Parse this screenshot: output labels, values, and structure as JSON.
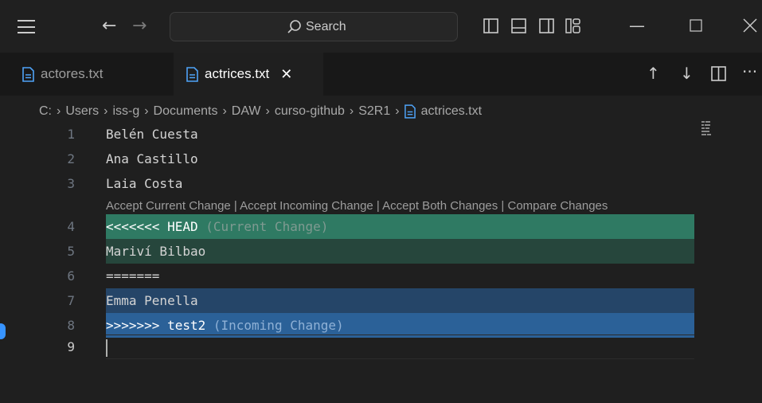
{
  "titlebar": {
    "search_placeholder": "Search",
    "icons": [
      "menu-icon",
      "arrow-left-icon",
      "arrow-right-icon",
      "search-icon",
      "toggle-primary-sidebar-icon",
      "toggle-panel-icon",
      "toggle-secondary-sidebar-icon",
      "customize-layout-icon",
      "minimize-icon",
      "maximize-icon",
      "close-icon"
    ]
  },
  "tabs": [
    {
      "label": "actores.txt",
      "active": false
    },
    {
      "label": "actrices.txt",
      "active": true
    }
  ],
  "tab_actions": [
    "arrow-up-icon",
    "arrow-down-icon",
    "split-editor-icon",
    "more-actions-icon"
  ],
  "breadcrumb": [
    "C:",
    "Users",
    "iss-g",
    "Documents",
    "DAW",
    "curso-github",
    "S2R1",
    "actrices.txt"
  ],
  "codelens": "Accept Current Change | Accept Incoming Change | Accept Both Changes | Compare Changes",
  "lines": [
    {
      "n": "1",
      "text": "Belén Cuesta"
    },
    {
      "n": "2",
      "text": "Ana Castillo"
    },
    {
      "n": "3",
      "text": "Laia Costa"
    },
    {
      "n": "4",
      "text": "<<<<<<< HEAD",
      "note": "(Current Change)"
    },
    {
      "n": "5",
      "text": "Mariví Bilbao"
    },
    {
      "n": "6",
      "text": "======="
    },
    {
      "n": "7",
      "text": "Emma Penella"
    },
    {
      "n": "8",
      "text": ">>>>>>> test2",
      "note": "(Incoming Change)"
    },
    {
      "n": "9",
      "text": ""
    }
  ],
  "colors": {
    "current_header": "#2f7a63",
    "current_body": "#26463c",
    "incoming_body": "#254568",
    "incoming_header": "#2b6198"
  }
}
